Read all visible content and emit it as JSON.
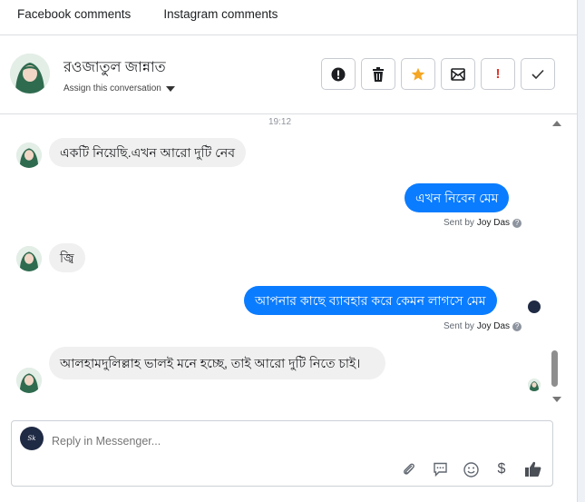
{
  "tabs": {
    "facebook": "Facebook comments",
    "instagram": "Instagram comments"
  },
  "header": {
    "contact_name": "রওজাতুল জান্নাত",
    "assign_label": "Assign this conversation",
    "actions": {
      "spam": "!",
      "important": "!"
    }
  },
  "chat": {
    "time": "19:12",
    "messages": [
      {
        "text": "একটি নিয়েছি.এখন আরো দুটি নেব"
      },
      {
        "text": "এখন নিবেন মেম"
      },
      {
        "text": "জ্বি"
      },
      {
        "text": "আপনার কাছে ব্যাবহার করে কেমন লাগসে মেম"
      },
      {
        "text": "আলহামদুলিল্লাহ ভালই মনে হচ্ছে, তাই আরো দুটি নিতে চাই।"
      }
    ],
    "sent_by_label": "Sent by",
    "agent_name": "Joy Das",
    "help_icon_label": "?"
  },
  "composer": {
    "placeholder": "Reply in Messenger...",
    "currency_label": "$"
  },
  "colors": {
    "outgoing_bubble": "#0a7cff",
    "incoming_bubble": "#f0f0f0",
    "star": "#f5a623",
    "spam": "#e0342a"
  }
}
